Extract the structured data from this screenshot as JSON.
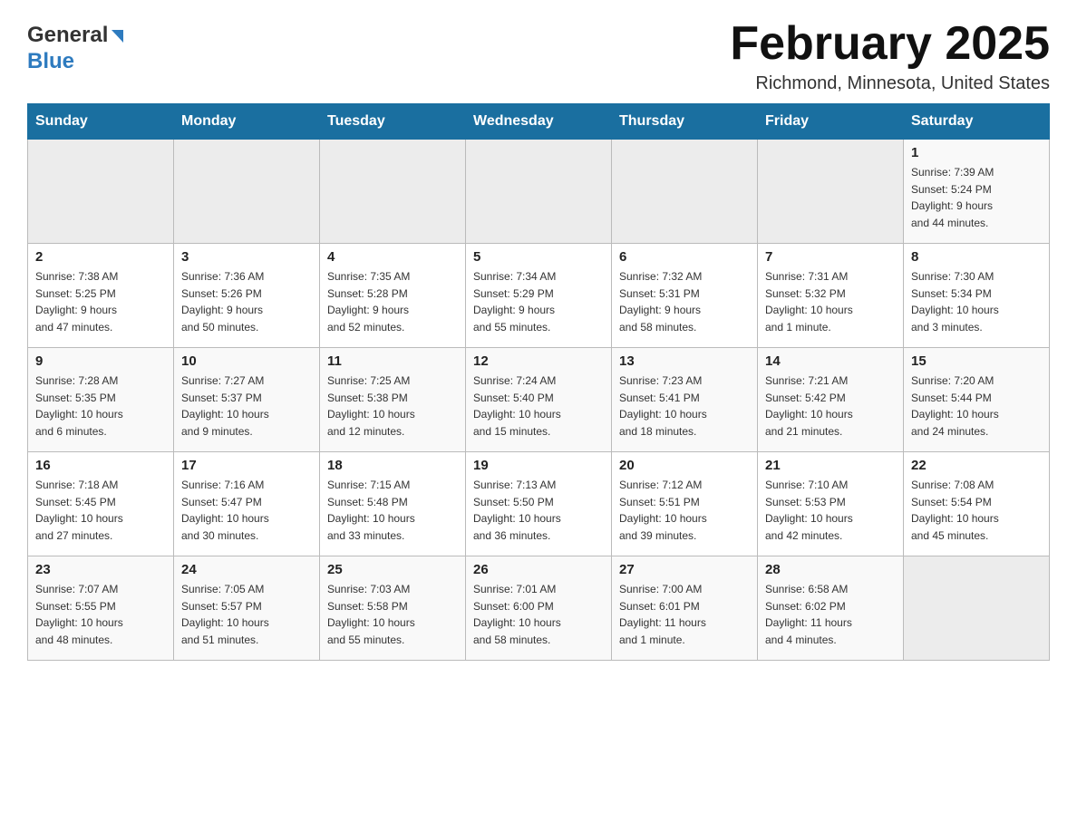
{
  "header": {
    "logo_general": "General",
    "logo_blue": "Blue",
    "month_title": "February 2025",
    "location": "Richmond, Minnesota, United States"
  },
  "days_of_week": [
    "Sunday",
    "Monday",
    "Tuesday",
    "Wednesday",
    "Thursday",
    "Friday",
    "Saturday"
  ],
  "weeks": [
    [
      {
        "day": "",
        "info": ""
      },
      {
        "day": "",
        "info": ""
      },
      {
        "day": "",
        "info": ""
      },
      {
        "day": "",
        "info": ""
      },
      {
        "day": "",
        "info": ""
      },
      {
        "day": "",
        "info": ""
      },
      {
        "day": "1",
        "info": "Sunrise: 7:39 AM\nSunset: 5:24 PM\nDaylight: 9 hours\nand 44 minutes."
      }
    ],
    [
      {
        "day": "2",
        "info": "Sunrise: 7:38 AM\nSunset: 5:25 PM\nDaylight: 9 hours\nand 47 minutes."
      },
      {
        "day": "3",
        "info": "Sunrise: 7:36 AM\nSunset: 5:26 PM\nDaylight: 9 hours\nand 50 minutes."
      },
      {
        "day": "4",
        "info": "Sunrise: 7:35 AM\nSunset: 5:28 PM\nDaylight: 9 hours\nand 52 minutes."
      },
      {
        "day": "5",
        "info": "Sunrise: 7:34 AM\nSunset: 5:29 PM\nDaylight: 9 hours\nand 55 minutes."
      },
      {
        "day": "6",
        "info": "Sunrise: 7:32 AM\nSunset: 5:31 PM\nDaylight: 9 hours\nand 58 minutes."
      },
      {
        "day": "7",
        "info": "Sunrise: 7:31 AM\nSunset: 5:32 PM\nDaylight: 10 hours\nand 1 minute."
      },
      {
        "day": "8",
        "info": "Sunrise: 7:30 AM\nSunset: 5:34 PM\nDaylight: 10 hours\nand 3 minutes."
      }
    ],
    [
      {
        "day": "9",
        "info": "Sunrise: 7:28 AM\nSunset: 5:35 PM\nDaylight: 10 hours\nand 6 minutes."
      },
      {
        "day": "10",
        "info": "Sunrise: 7:27 AM\nSunset: 5:37 PM\nDaylight: 10 hours\nand 9 minutes."
      },
      {
        "day": "11",
        "info": "Sunrise: 7:25 AM\nSunset: 5:38 PM\nDaylight: 10 hours\nand 12 minutes."
      },
      {
        "day": "12",
        "info": "Sunrise: 7:24 AM\nSunset: 5:40 PM\nDaylight: 10 hours\nand 15 minutes."
      },
      {
        "day": "13",
        "info": "Sunrise: 7:23 AM\nSunset: 5:41 PM\nDaylight: 10 hours\nand 18 minutes."
      },
      {
        "day": "14",
        "info": "Sunrise: 7:21 AM\nSunset: 5:42 PM\nDaylight: 10 hours\nand 21 minutes."
      },
      {
        "day": "15",
        "info": "Sunrise: 7:20 AM\nSunset: 5:44 PM\nDaylight: 10 hours\nand 24 minutes."
      }
    ],
    [
      {
        "day": "16",
        "info": "Sunrise: 7:18 AM\nSunset: 5:45 PM\nDaylight: 10 hours\nand 27 minutes."
      },
      {
        "day": "17",
        "info": "Sunrise: 7:16 AM\nSunset: 5:47 PM\nDaylight: 10 hours\nand 30 minutes."
      },
      {
        "day": "18",
        "info": "Sunrise: 7:15 AM\nSunset: 5:48 PM\nDaylight: 10 hours\nand 33 minutes."
      },
      {
        "day": "19",
        "info": "Sunrise: 7:13 AM\nSunset: 5:50 PM\nDaylight: 10 hours\nand 36 minutes."
      },
      {
        "day": "20",
        "info": "Sunrise: 7:12 AM\nSunset: 5:51 PM\nDaylight: 10 hours\nand 39 minutes."
      },
      {
        "day": "21",
        "info": "Sunrise: 7:10 AM\nSunset: 5:53 PM\nDaylight: 10 hours\nand 42 minutes."
      },
      {
        "day": "22",
        "info": "Sunrise: 7:08 AM\nSunset: 5:54 PM\nDaylight: 10 hours\nand 45 minutes."
      }
    ],
    [
      {
        "day": "23",
        "info": "Sunrise: 7:07 AM\nSunset: 5:55 PM\nDaylight: 10 hours\nand 48 minutes."
      },
      {
        "day": "24",
        "info": "Sunrise: 7:05 AM\nSunset: 5:57 PM\nDaylight: 10 hours\nand 51 minutes."
      },
      {
        "day": "25",
        "info": "Sunrise: 7:03 AM\nSunset: 5:58 PM\nDaylight: 10 hours\nand 55 minutes."
      },
      {
        "day": "26",
        "info": "Sunrise: 7:01 AM\nSunset: 6:00 PM\nDaylight: 10 hours\nand 58 minutes."
      },
      {
        "day": "27",
        "info": "Sunrise: 7:00 AM\nSunset: 6:01 PM\nDaylight: 11 hours\nand 1 minute."
      },
      {
        "day": "28",
        "info": "Sunrise: 6:58 AM\nSunset: 6:02 PM\nDaylight: 11 hours\nand 4 minutes."
      },
      {
        "day": "",
        "info": ""
      }
    ]
  ]
}
